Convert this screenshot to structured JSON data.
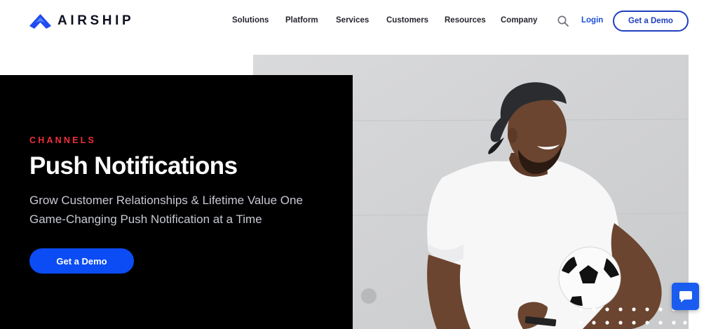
{
  "brand": {
    "name": "AIRSHIP",
    "logo_color": "#1f4cf0"
  },
  "nav": {
    "items": [
      {
        "label": "Solutions"
      },
      {
        "label": "Platform"
      },
      {
        "label": "Services"
      },
      {
        "label": "Customers"
      },
      {
        "label": "Resources"
      },
      {
        "label": "Company"
      }
    ],
    "search_icon": "search-icon",
    "login_label": "Login",
    "demo_label": "Get a Demo"
  },
  "hero": {
    "eyebrow": "CHANNELS",
    "title": "Push Notifications",
    "subtitle_line1": "Grow Customer Relationships & Lifetime Value One",
    "subtitle_line2": "Game-Changing Push Notification at a Time",
    "cta_label": "Get a Demo",
    "image_description_icon": "photo-man-with-soccer-ball"
  },
  "chat_widget": {
    "icon": "chat-bubble-icon"
  },
  "colors": {
    "primary_blue": "#0c4cf5",
    "accent_red": "#ef2e3d",
    "panel_black": "#000000",
    "nav_text": "#25252f",
    "login_blue": "#1b4ed8"
  }
}
